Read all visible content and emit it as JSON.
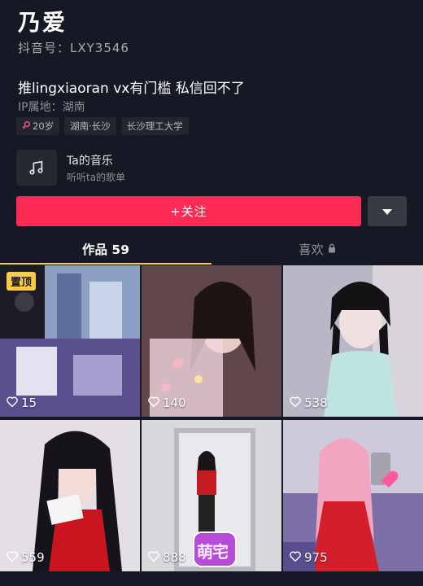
{
  "profile": {
    "name": "乃爱",
    "douyin_id": "抖音号：LXY3546",
    "bio": "推lingxiaoran vx有门槛 私信回不了",
    "ip": "IP属地：湖南",
    "tags": {
      "age": "20岁",
      "location": "湖南·长沙",
      "school": "长沙理工大学"
    },
    "gender_icon": "female-icon"
  },
  "music": {
    "title": "Ta的音乐",
    "subtitle": "听听ta的歌单",
    "icon": "music-note-icon"
  },
  "actions": {
    "follow_label": "+关注",
    "more_icon": "triangle-down-icon"
  },
  "tabs": {
    "works_label": "作品 59",
    "likes_label": "喜欢",
    "likes_icon": "lock-icon"
  },
  "grid": {
    "pin_label": "置顶",
    "sticker_text": "萌宅",
    "items": [
      {
        "likes": "15"
      },
      {
        "likes": "140"
      },
      {
        "likes": "538"
      },
      {
        "likes": "559"
      },
      {
        "likes": "888"
      },
      {
        "likes": "975"
      }
    ]
  },
  "colors": {
    "background": "#161823",
    "accent": "#fe2c55",
    "tab_indicator": "#facc45"
  }
}
